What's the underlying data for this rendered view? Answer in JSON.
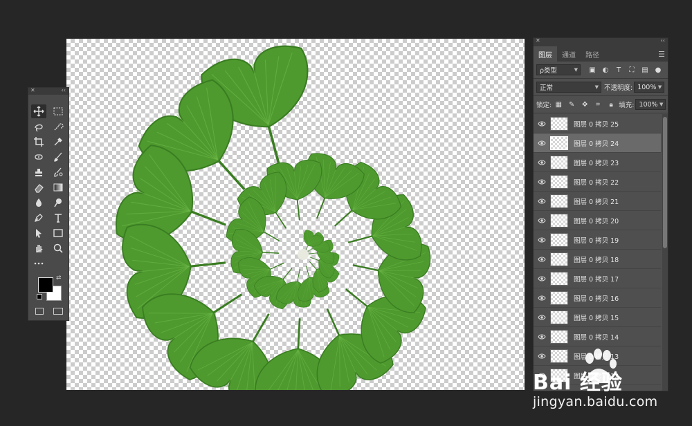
{
  "colors": {
    "app_background": "#262626",
    "leaf_green": "#4e9a2e",
    "leaf_dark": "#3a7d22",
    "selected_layer": "#6a6a6a"
  },
  "toolbox": {
    "tools": [
      "move-icon",
      "marquee-icon",
      "lasso-icon",
      "quick-select-icon",
      "crop-icon",
      "eyedropper-icon",
      "spot-heal-icon",
      "brush-icon",
      "stamp-icon",
      "history-brush-icon",
      "eraser-icon",
      "gradient-icon",
      "blur-icon",
      "dodge-icon",
      "pen-icon",
      "type-icon",
      "path-select-icon",
      "rectangle-icon",
      "hand-icon",
      "zoom-icon",
      "more-tools-icon"
    ],
    "foreground_color": "#000000",
    "background_color": "#ffffff"
  },
  "layers_panel": {
    "tabs": [
      "图层",
      "通道",
      "路径"
    ],
    "active_tab": "图层",
    "filter_label": "ρ类型",
    "blend_mode": "正常",
    "opacity_label": "不透明度:",
    "opacity_value": "100%",
    "lock_label": "锁定:",
    "fill_label": "填充:",
    "fill_value": "100%",
    "layers": [
      {
        "name": "图层 0 拷贝 25",
        "selected": false
      },
      {
        "name": "图层 0 拷贝 24",
        "selected": true
      },
      {
        "name": "图层 0 拷贝 23",
        "selected": false
      },
      {
        "name": "图层 0 拷贝 22",
        "selected": false
      },
      {
        "name": "图层 0 拷贝 21",
        "selected": false
      },
      {
        "name": "图层 0 拷贝 20",
        "selected": false
      },
      {
        "name": "图层 0 拷贝 19",
        "selected": false
      },
      {
        "name": "图层 0 拷贝 18",
        "selected": false
      },
      {
        "name": "图层 0 拷贝 17",
        "selected": false
      },
      {
        "name": "图层 0 拷贝 16",
        "selected": false
      },
      {
        "name": "图层 0 拷贝 15",
        "selected": false
      },
      {
        "name": "图层 0 拷贝 14",
        "selected": false
      },
      {
        "name": "图层 0 拷贝 13",
        "selected": false
      },
      {
        "name": "图层 0 拷贝 12",
        "selected": false
      }
    ]
  },
  "watermark": {
    "brand": "Bai 经验",
    "url": "jingyan.baidu.com"
  }
}
